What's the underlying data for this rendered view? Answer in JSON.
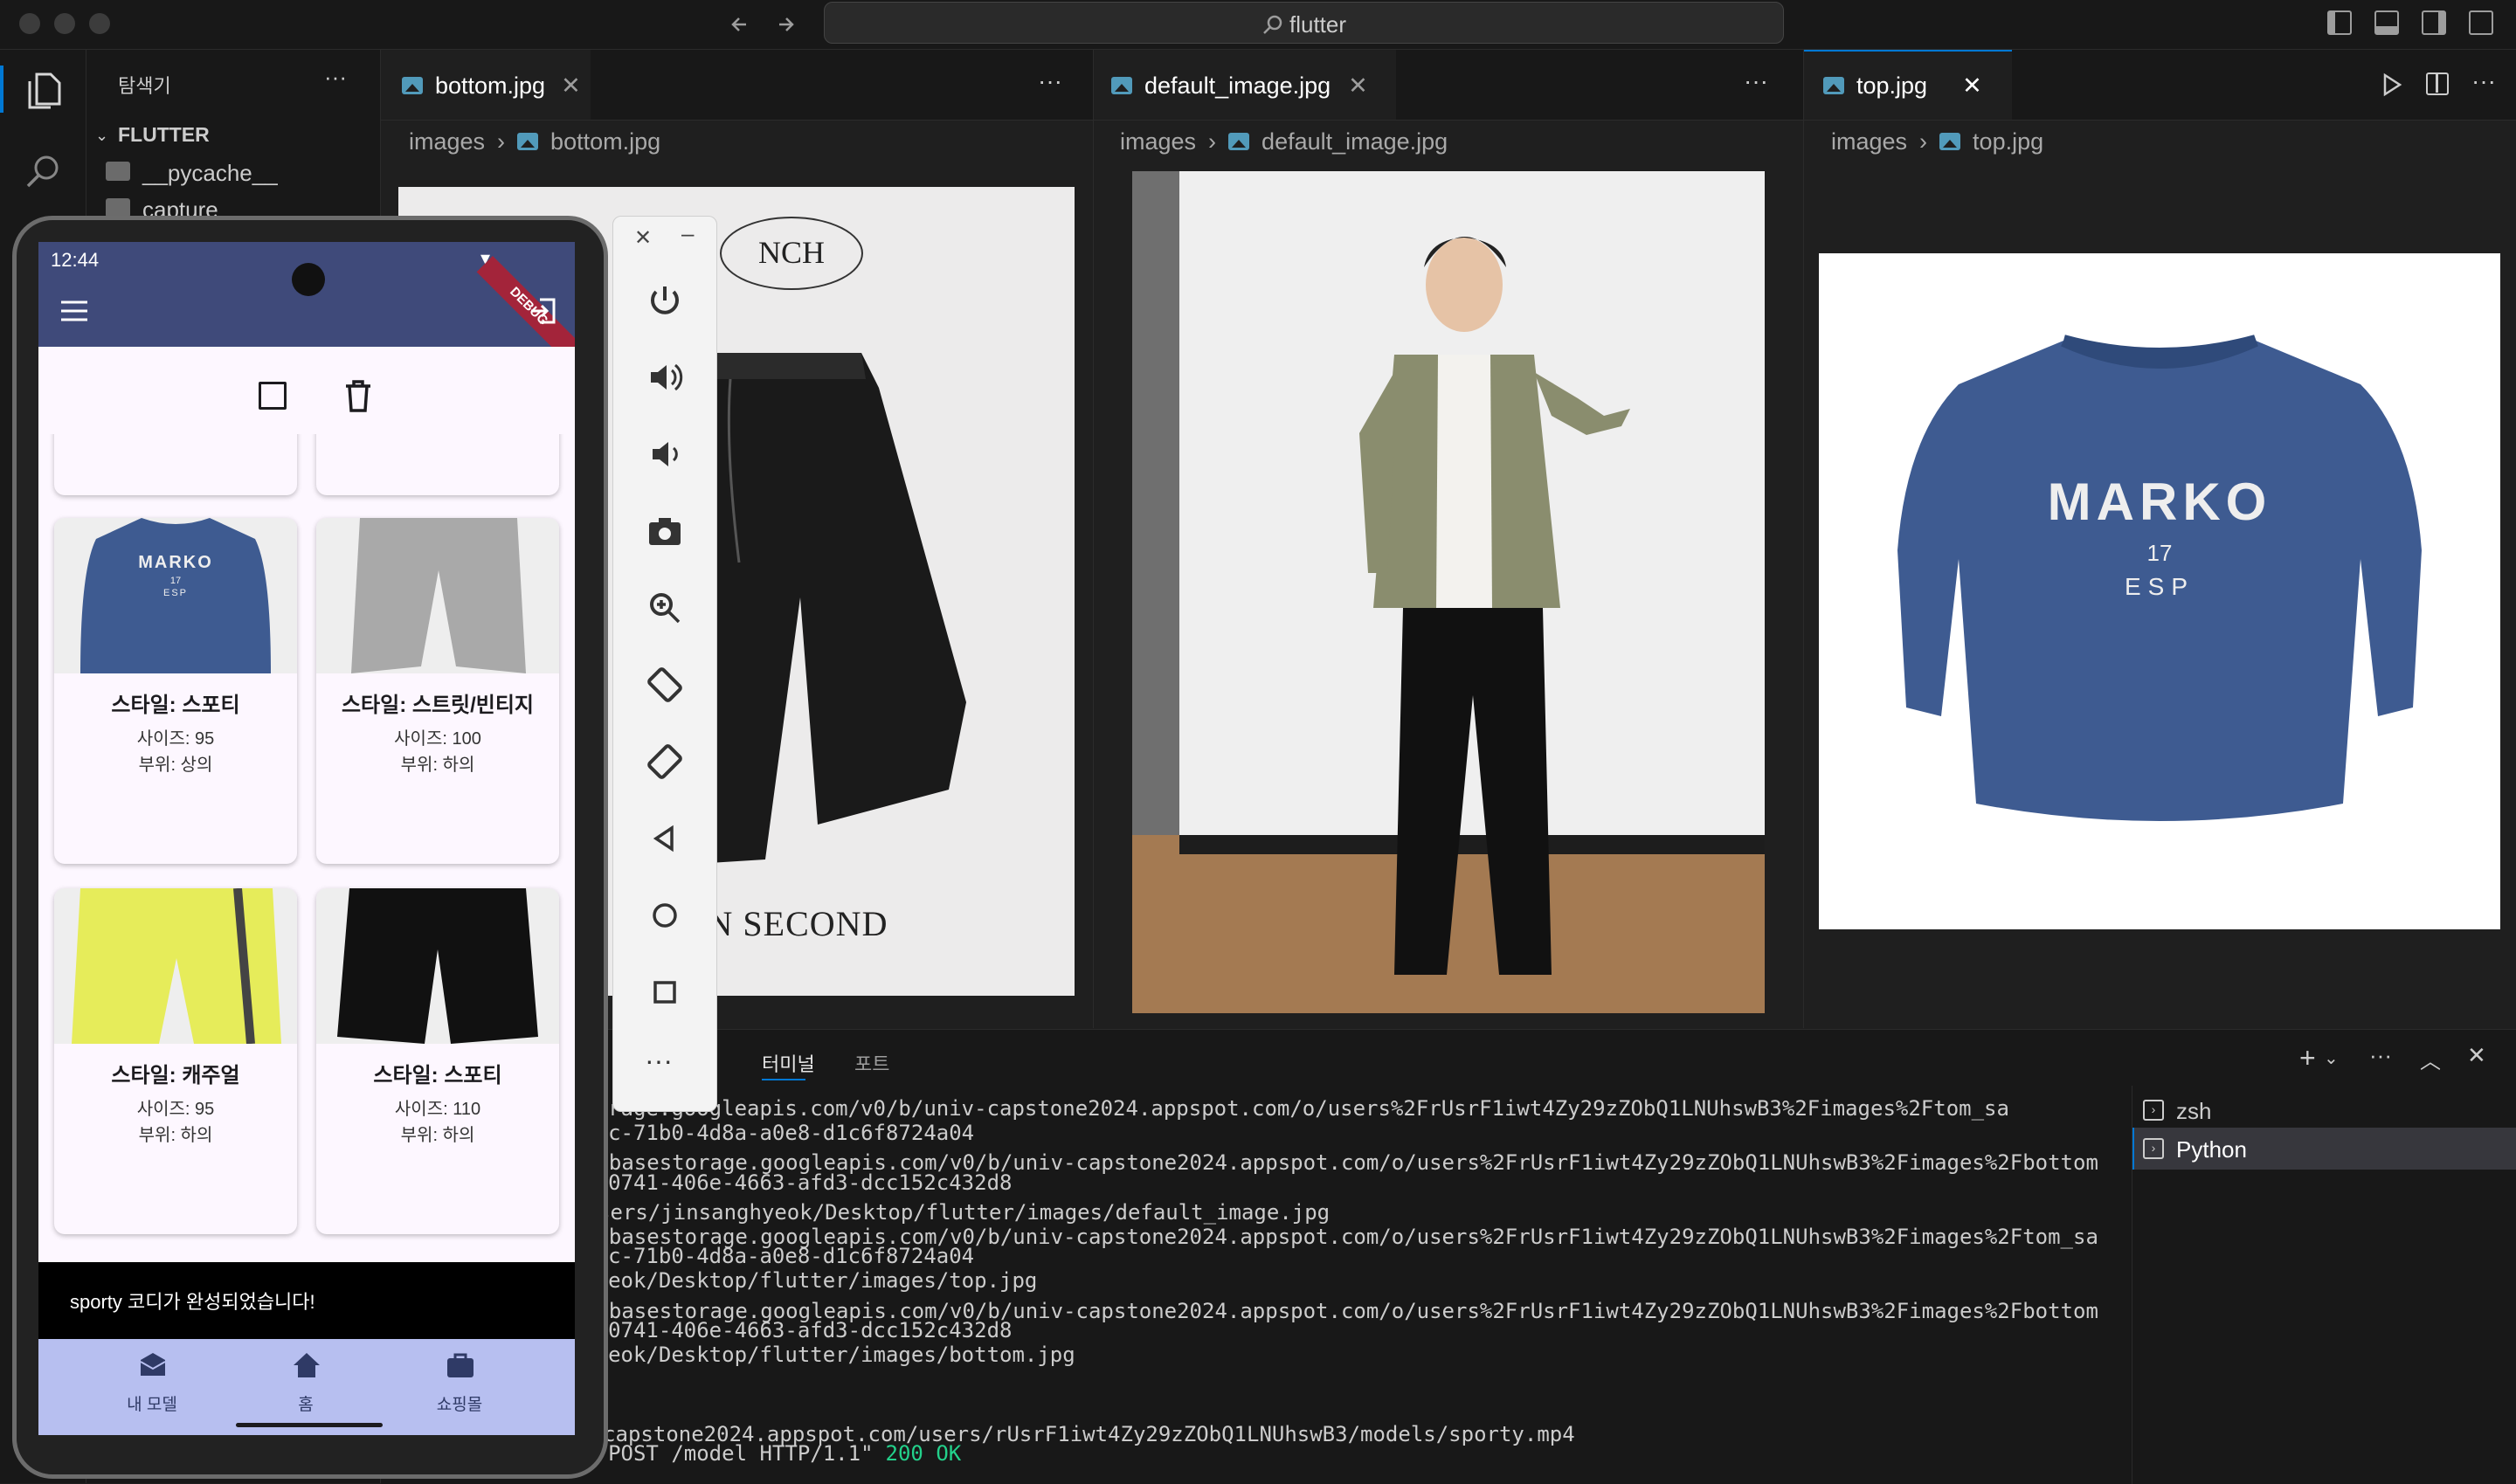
{
  "titlebar": {
    "search_text": "flutter"
  },
  "sidebar": {
    "title": "탐색기",
    "more": "···",
    "root": "FLUTTER",
    "items": [
      {
        "label": "__pycache__"
      },
      {
        "label": "capture"
      }
    ]
  },
  "editors": [
    {
      "tab": "bottom.jpg",
      "crumb_folder": "images",
      "crumb_file": "bottom.jpg"
    },
    {
      "tab": "default_image.jpg",
      "crumb_folder": "images",
      "crumb_file": "default_image.jpg"
    },
    {
      "tab": "top.jpg",
      "crumb_folder": "images",
      "crumb_file": "top.jpg"
    }
  ],
  "bottom_image": {
    "brand_text": "NCH",
    "bottom_text": "N SECOND"
  },
  "top_image": {
    "print": "MARKO",
    "num": "17",
    "sub": "ESP"
  },
  "panel": {
    "tabs": [
      "터미널",
      "포트"
    ],
    "terminals": [
      "zsh",
      "Python"
    ],
    "lines": [
      "ttps://firebasestorage.googleapis.com/v0/b/univ-capstone2024.appspot.com/o/users%2FrUsrF1iwt4Zy29zZObQ1LNUhswB3%2Fimages%2Ftom_sa",
      "edia&token=eba3ea8c-71b0-4d8a-a0e8-d1c6f8724a04",
      " 시작: https://firebasestorage.googleapis.com/v0/b/univ-capstone2024.appspot.com/o/users%2FrUsrF1iwt4Zy29zZObQ1LNUhswB3%2Fimages%2Fbottom",
      "t=media&token=8deb0741-406e-4663-afd3-dcc152c432d8",
      "pg 다운로드 완료: /Users/jinsanghyeok/Desktop/flutter/images/default_image.jpg",
      " 성공: https://firebasestorage.googleapis.com/v0/b/univ-capstone2024.appspot.com/o/users%2FrUsrF1iwt4Zy29zZObQ1LNUhswB3%2Fimages%2Ftom_sa",
      "edia&token=eba3ea8c-71b0-4d8a-a0e8-d1c6f8724a04",
      ": /Users/jinsanghyeok/Desktop/flutter/images/top.jpg",
      " 성공: https://firebasestorage.googleapis.com/v0/b/univ-capstone2024.appspot.com/o/users%2FrUsrF1iwt4Zy29zZObQ1LNUhswB3%2Fimages%2Fbottom",
      "t=media&token=8deb0741-406e-4663-afd3-dcc152c432d8",
      ": /Users/jinsanghyeok/Desktop/flutter/images/bottom.jpg",
      "!",
      "deos/sporty.mp4",
      "드 완료: gs://univ-capstone2024.appspot.com/users/rUsrF1iwt4Zy29zZObQ1LNUhswB3/models/sporty.mp4"
    ],
    "last_line": "18.8.232:57357 - \"POST /model HTTP/1.1\"",
    "status": "200 OK",
    "status_color": "#23d18b"
  },
  "phone": {
    "time": "12:44",
    "debug": "DEBUG",
    "appbar_color": "#3f4a7a",
    "cards": [
      {
        "style": "스타일: 스포티",
        "size": "사이즈: 95",
        "part": "부위: 상의",
        "print": "MARKO",
        "num": "17",
        "sub": "ESP"
      },
      {
        "style": "스타일: 스트릿/빈티지",
        "size": "사이즈: 100",
        "part": "부위: 하의"
      },
      {
        "style": "스타일: 캐주얼",
        "size": "사이즈: 95",
        "part": "부위: 하의"
      },
      {
        "style": "스타일: 스포티",
        "size": "사이즈: 110",
        "part": "부위: 하의"
      }
    ],
    "snackbar": "sporty 코디가 완성되었습니다!",
    "nav": [
      {
        "label": "내 모델"
      },
      {
        "label": "홈"
      },
      {
        "label": "쇼핑몰"
      }
    ],
    "nav_color": "#b7bff0"
  }
}
